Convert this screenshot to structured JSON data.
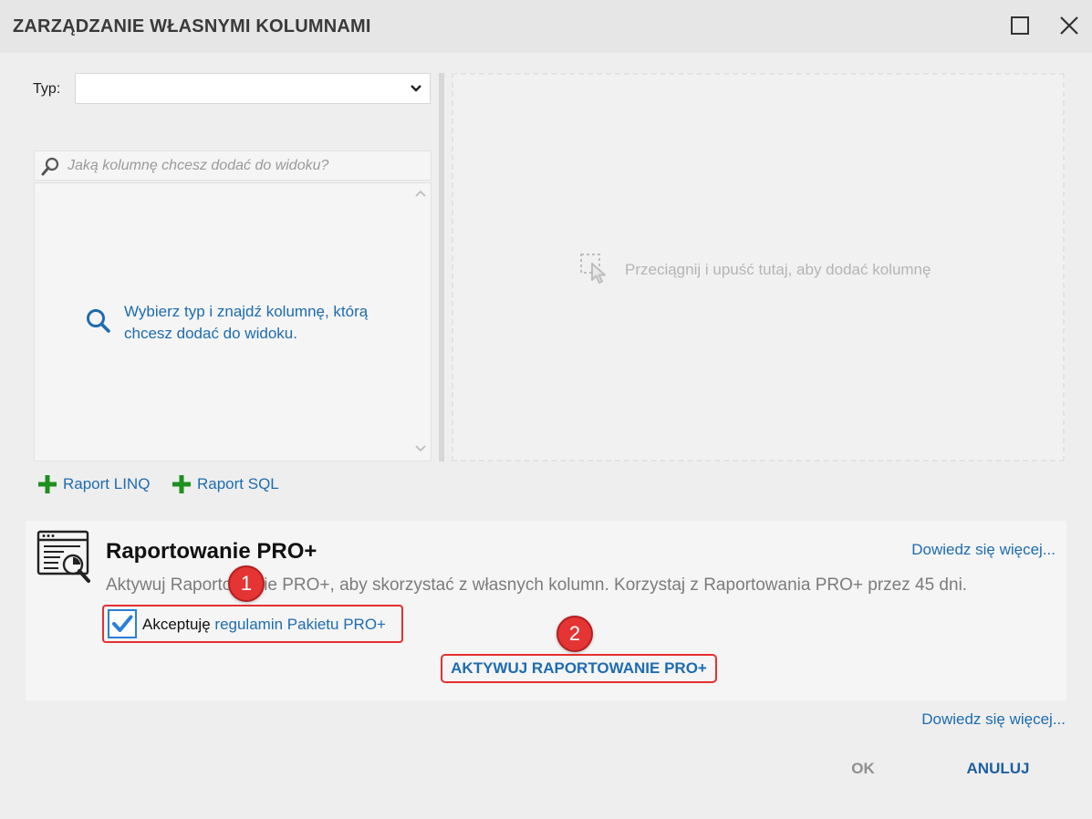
{
  "window": {
    "title": "ZARZĄDZANIE WŁASNYMI KOLUMNAMI",
    "maximize_icon": "maximize-icon",
    "close_icon": "close-icon"
  },
  "type_filter": {
    "label": "Typ:",
    "selected_value": ""
  },
  "search": {
    "placeholder": "Jaką kolumnę chcesz dodać do widoku?",
    "value": ""
  },
  "column_list": {
    "hint": "Wybierz typ i znajdź kolumnę, którą chcesz dodać do widoku."
  },
  "drop_zone": {
    "text": "Przeciągnij i upuść tutaj, aby dodać kolumnę"
  },
  "add_links": [
    {
      "label": "Raport LINQ",
      "icon": "plus-icon"
    },
    {
      "label": "Raport SQL",
      "icon": "plus-icon"
    }
  ],
  "pro_panel": {
    "title": "Raportowanie PRO+",
    "learn_more": "Dowiedz się więcej...",
    "description": "Aktywuj Raportowanie PRO+, aby skorzystać z własnych kolumn. Korzystaj z Raportowania PRO+ przez 45 dni.",
    "accept_prefix": "Akceptuję",
    "accept_link": "regulamin Pakietu PRO+",
    "accept_checked": true,
    "activate_button": "AKTYWUJ RAPORTOWANIE PRO+"
  },
  "annotations": {
    "badge_1": "1",
    "badge_2": "2",
    "highlight_color": "#e53030"
  },
  "footer": {
    "learn_more": "Dowiedz się więcej...",
    "ok": "OK",
    "cancel": "ANULUJ"
  },
  "colors": {
    "link_blue": "#1e6cb0",
    "plus_green": "#1f8f1f",
    "checkbox_blue": "#2b7fd6"
  }
}
